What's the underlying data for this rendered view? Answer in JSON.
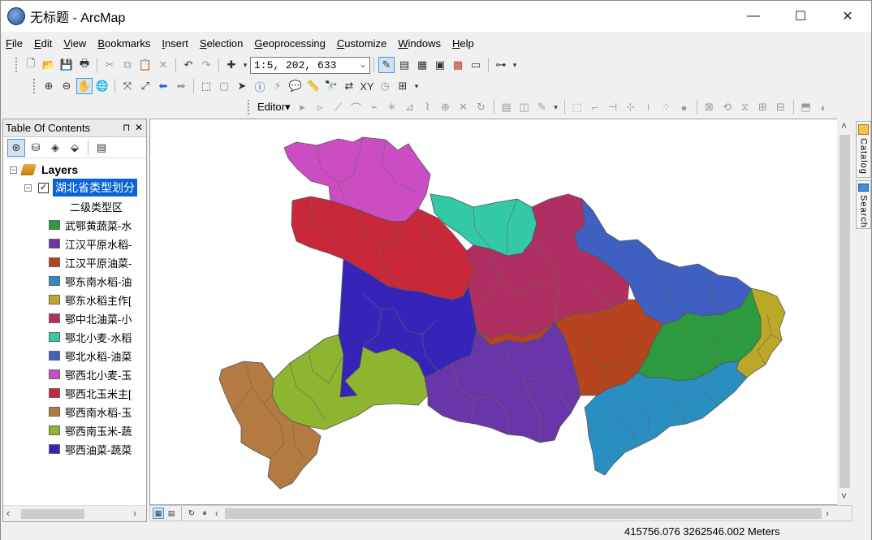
{
  "window": {
    "title": "无标题 - ArcMap",
    "minimize_label": "—",
    "maximize_label": "☐",
    "close_label": "✕"
  },
  "menu": [
    {
      "label": "File",
      "accel": "F"
    },
    {
      "label": "Edit",
      "accel": "E"
    },
    {
      "label": "View",
      "accel": "V"
    },
    {
      "label": "Bookmarks",
      "accel": "B"
    },
    {
      "label": "Insert",
      "accel": "I"
    },
    {
      "label": "Selection",
      "accel": "S"
    },
    {
      "label": "Geoprocessing",
      "accel": "G"
    },
    {
      "label": "Customize",
      "accel": "C"
    },
    {
      "label": "Windows",
      "accel": "W"
    },
    {
      "label": "Help",
      "accel": "H"
    }
  ],
  "standard_toolbar": {
    "scale": "1:5, 202, 633"
  },
  "editor_toolbar": {
    "label": "Editor▾"
  },
  "toc": {
    "title": "Table Of Contents",
    "pin_label": "⊓",
    "close_label": "✕",
    "root_label": "Layers",
    "layer_name": "湖北省类型划分",
    "field_name": "二级类型区",
    "legend": [
      {
        "label": "武鄂黄蔬菜-水",
        "color": "#2e9a3f"
      },
      {
        "label": "江汉平原水稻-",
        "color": "#6a35a8"
      },
      {
        "label": "江汉平原油菜-",
        "color": "#b5441f"
      },
      {
        "label": "鄂东南水稻-油",
        "color": "#2a8fc0"
      },
      {
        "label": "鄂东水稻主作[",
        "color": "#bca827"
      },
      {
        "label": "鄂中北油菜-小",
        "color": "#b02f63"
      },
      {
        "label": "鄂北小麦-水稻",
        "color": "#33c8a6"
      },
      {
        "label": "鄂北水稻-油菜",
        "color": "#3f5fc2"
      },
      {
        "label": "鄂西北小麦-玉",
        "color": "#cc4dc2"
      },
      {
        "label": "鄂西北玉米主[",
        "color": "#c8283a"
      },
      {
        "label": "鄂西南水稻-玉",
        "color": "#b37a42"
      },
      {
        "label": "鄂西南玉米-蔬",
        "color": "#8db52f"
      },
      {
        "label": "鄂西油菜-蔬菜",
        "color": "#3623b8"
      }
    ]
  },
  "dock": {
    "catalog": "Catalog",
    "search": "Search"
  },
  "status": {
    "coordinates": "415756.076  3262546.002 Meters"
  }
}
